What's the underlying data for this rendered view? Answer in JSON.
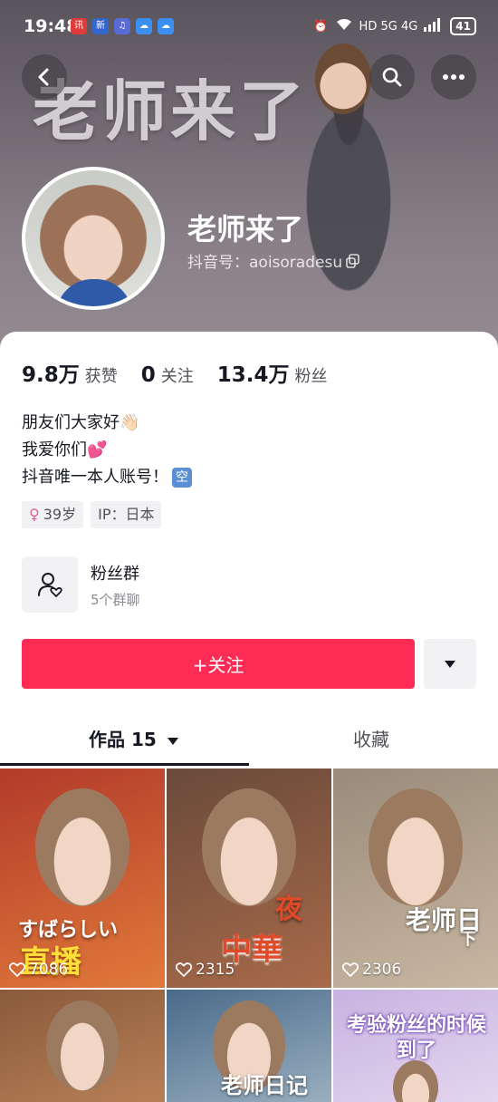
{
  "status_bar": {
    "time": "19:48",
    "apps": [
      {
        "icon": "news-app-icon",
        "label": "讯",
        "color": "#e03b3b"
      },
      {
        "icon": "new-app-icon",
        "label": "新",
        "color": "#3366cc"
      },
      {
        "icon": "music-app-icon",
        "label": "♫",
        "color": "#5b6bd6"
      },
      {
        "icon": "cloud-icon",
        "label": "☁",
        "color": "#3b8ff0"
      },
      {
        "icon": "cloud-icon",
        "label": "☁",
        "color": "#3b8ff0"
      }
    ],
    "network": "HD 5G 4G",
    "battery": "41"
  },
  "cover": {
    "title": "老师来了"
  },
  "profile": {
    "name": "老师来了",
    "douyin_id": "抖音号：aoisoradesu"
  },
  "stats": [
    {
      "value": "9.8万",
      "label": "获赞"
    },
    {
      "value": "0",
      "label": "关注"
    },
    {
      "value": "13.4万",
      "label": "粉丝"
    }
  ],
  "bio": {
    "line1": "朋友们大家好👋🏻",
    "line2": "我爱你们💕",
    "line3": "抖音唯一本人账号！",
    "line3_badge": "空"
  },
  "tags": {
    "age": "39岁",
    "ip": "IP：日本"
  },
  "fan_group": {
    "title": "粉丝群",
    "subtitle": "5个群聊"
  },
  "follow_label": "+关注",
  "tabs": {
    "works": "作品 15",
    "favorites": "收藏"
  },
  "videos": [
    {
      "likes": "7086",
      "caption": "直播",
      "caption_sub": "すばらしい",
      "colors": {
        "bg": "#b23a2a",
        "bg2": "#e07a3a"
      }
    },
    {
      "likes": "2315",
      "caption": "中華",
      "caption_sub": "夜",
      "colors": {
        "bg": "#6a4a3a",
        "bg2": "#a86a4a"
      }
    },
    {
      "likes": "2306",
      "caption": "老师日",
      "caption_sub": "下",
      "colors": {
        "bg": "#9a8a7a",
        "bg2": "#c8b8a2"
      }
    },
    {
      "likes": "",
      "caption": "",
      "caption_sub": "",
      "colors": {
        "bg": "#8a5a3a",
        "bg2": "#b88058"
      }
    },
    {
      "likes": "",
      "caption": "老师日记",
      "caption_sub": "",
      "colors": {
        "bg": "#4a6a8a",
        "bg2": "#9ab0c0"
      }
    },
    {
      "likes": "",
      "caption": "考验粉丝的时候到了",
      "caption_sub": "",
      "colors": {
        "bg": "#c8b2e0",
        "bg2": "#e4d6f0"
      }
    }
  ],
  "colors": {
    "accent": "#fe2c55",
    "text_primary": "#161823",
    "text_secondary": "#50525a"
  }
}
